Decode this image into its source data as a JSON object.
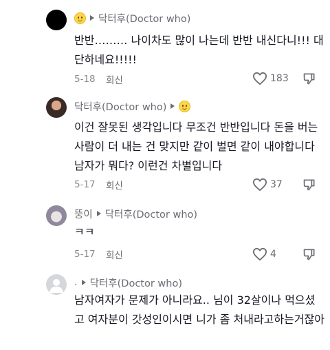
{
  "comments": [
    {
      "author_prefix": "",
      "author": "",
      "reply_to": "닥터후(Doctor who)",
      "lead_emoji": true,
      "trail_emoji": false,
      "text": "반반……… 나이차도 많이 나는데 반반 내신다니!!! 대단하네요!!!!!",
      "date": "5-18",
      "reply_label": "회신",
      "likes": "183"
    },
    {
      "author": "닥터후(Doctor who)",
      "reply_to": "",
      "lead_emoji": false,
      "trail_emoji": true,
      "text": "이건 잘못된 생각입니다 무조건 반반입니다 돈을 버는 사람이 더 내는 건 맞지만 같이 벌면 같이 내야합니다 남자가 뭐다? 이런건 차별입니다",
      "date": "5-17",
      "reply_label": "회신",
      "likes": "37"
    },
    {
      "author": "뚱이",
      "reply_to": "닥터후(Doctor who)",
      "lead_emoji": false,
      "trail_emoji": false,
      "text": "ㅋㅋ",
      "date": "5-17",
      "reply_label": "회신",
      "likes": "4"
    },
    {
      "author": ".",
      "reply_to": "닥터후(Doctor who)",
      "lead_emoji": false,
      "trail_emoji": false,
      "text": "남자여자가 문제가 아니라요.. 님이 32살이나 먹으셨고 여자분이 갓성인이시면 니가 좀 처내라고하는거잖아",
      "date": "",
      "reply_label": "",
      "likes": ""
    }
  ],
  "icons": {
    "like": "heart-outline-icon",
    "dislike": "thumbs-down-icon",
    "reply_arrow": "triangle-right-icon",
    "emoji": "smiley-emoji-icon"
  },
  "colors": {
    "text": "#161823",
    "secondary": "#6b6c73",
    "muted": "#8a8b91"
  }
}
